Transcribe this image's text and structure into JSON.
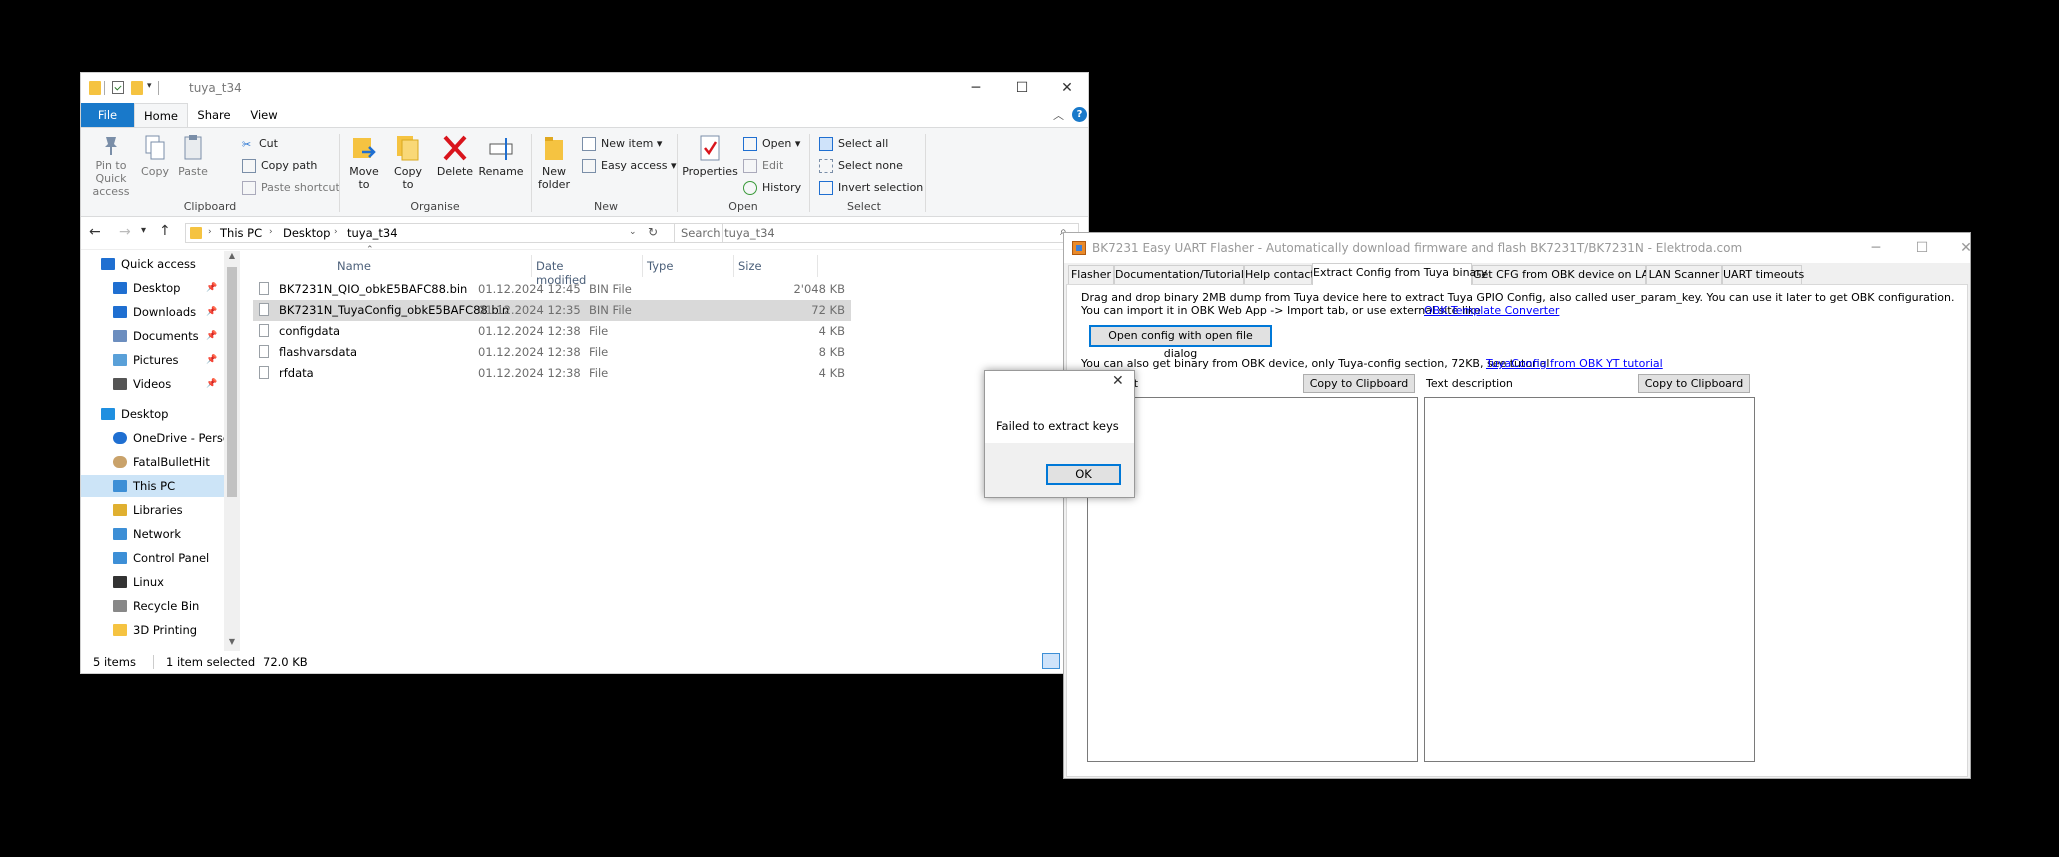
{
  "explorer": {
    "title": "tuya_t34",
    "tabs": [
      "File",
      "Home",
      "Share",
      "View"
    ],
    "ribbon": {
      "clipboard": {
        "pin": "Pin to Quick access",
        "copy": "Copy",
        "paste": "Paste",
        "cut": "Cut",
        "copy_path": "Copy path",
        "paste_shortcut": "Paste shortcut",
        "label": "Clipboard"
      },
      "organise": {
        "move_to": "Move to",
        "copy_to": "Copy to",
        "delete": "Delete",
        "rename": "Rename",
        "label": "Organise"
      },
      "new": {
        "new_folder": "New folder",
        "new_item": "New item",
        "easy_access": "Easy access",
        "label": "New"
      },
      "open": {
        "properties": "Properties",
        "open": "Open",
        "edit": "Edit",
        "history": "History",
        "label": "Open"
      },
      "select": {
        "select_all": "Select all",
        "select_none": "Select none",
        "invert": "Invert selection",
        "label": "Select"
      }
    },
    "address": [
      "This PC",
      "Desktop",
      "tuya_t34"
    ],
    "search_placeholder": "Search tuya_t34",
    "nav": [
      {
        "label": "Quick access",
        "icon": "star-icon",
        "color": "#1f6fd1"
      },
      {
        "label": "Desktop",
        "icon": "desktop-icon",
        "color": "#1f6fd1",
        "pinned": true
      },
      {
        "label": "Downloads",
        "icon": "download-icon",
        "color": "#1f6fd1",
        "pinned": true
      },
      {
        "label": "Documents",
        "icon": "documents-icon",
        "color": "#6c8ebf",
        "pinned": true
      },
      {
        "label": "Pictures",
        "icon": "pictures-icon",
        "color": "#5aa0d8",
        "pinned": true
      },
      {
        "label": "Videos",
        "icon": "videos-icon",
        "color": "#555",
        "pinned": true
      },
      {
        "label": "Desktop",
        "icon": "desktop-icon",
        "color": "#1f8fe0"
      },
      {
        "label": "OneDrive - Perso",
        "icon": "cloud-icon",
        "color": "#1f6fd1"
      },
      {
        "label": "FatalBulletHit",
        "icon": "user-icon",
        "color": "#c9a26a"
      },
      {
        "label": "This PC",
        "icon": "computer-icon",
        "color": "#3d8fd6"
      },
      {
        "label": "Libraries",
        "icon": "libraries-icon",
        "color": "#e0b030"
      },
      {
        "label": "Network",
        "icon": "network-icon",
        "color": "#3d8fd6"
      },
      {
        "label": "Control Panel",
        "icon": "control-panel-icon",
        "color": "#3d8fd6"
      },
      {
        "label": "Linux",
        "icon": "linux-icon",
        "color": "#333"
      },
      {
        "label": "Recycle Bin",
        "icon": "recycle-bin-icon",
        "color": "#888"
      },
      {
        "label": "3D Printing",
        "icon": "folder-icon",
        "color": "#f5c341"
      }
    ],
    "columns": [
      "Name",
      "Date modified",
      "Type",
      "Size"
    ],
    "files": [
      {
        "name": "BK7231N_QIO_obkE5BAFC88.bin",
        "date": "01.12.2024 12:45",
        "type": "BIN File",
        "size": "2'048 KB"
      },
      {
        "name": "BK7231N_TuyaConfig_obkE5BAFC88.bin",
        "date": "01.12.2024 12:35",
        "type": "BIN File",
        "size": "72 KB",
        "selected": true
      },
      {
        "name": "configdata",
        "date": "01.12.2024 12:38",
        "type": "File",
        "size": "4 KB"
      },
      {
        "name": "flashvarsdata",
        "date": "01.12.2024 12:38",
        "type": "File",
        "size": "8 KB"
      },
      {
        "name": "rfdata",
        "date": "01.12.2024 12:38",
        "type": "File",
        "size": "4 KB"
      }
    ],
    "status": {
      "count": "5 items",
      "selected": "1 item selected",
      "size": "72.0 KB"
    }
  },
  "flasher": {
    "title": "BK7231 Easy UART Flasher - Automatically download firmware and flash BK7231T/BK7231N  - Elektroda.com",
    "tabs": [
      "Flasher",
      "Documentation/Tutorials",
      "Help contact",
      "Extract Config from Tuya binary",
      "Get CFG from OBK device on LAN",
      "LAN Scanner",
      "UART timeouts"
    ],
    "line1": "Drag and drop binary 2MB dump from Tuya device here to extract Tuya GPIO Config, also called user_param_key. You can use it later to get OBK configuration.",
    "line2": "You can import it in OBK Web App -> Import tab, or use external site like",
    "line2_link": "OBK Template Converter",
    "open_button": "Open config with open file dialog",
    "line3": "You can also get binary from OBK device, only Tuya-config section, 72KB, see tutorial",
    "line3_link": "TuyaConfig from OBK YT tutorial",
    "left_label": "at",
    "copy_button": "Copy to Clipboard",
    "right_label": "Text description"
  },
  "dialog": {
    "message": "Failed to extract keys",
    "ok": "OK"
  }
}
